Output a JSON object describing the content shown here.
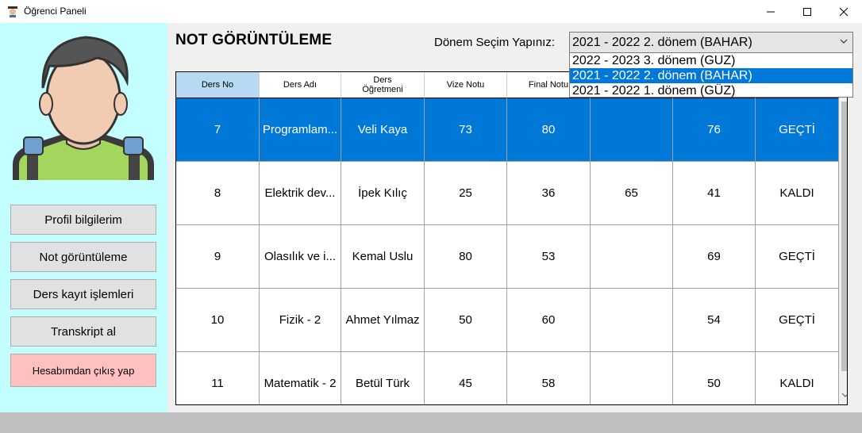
{
  "window": {
    "title": "Öğrenci Paneli"
  },
  "sidebar": {
    "buttons": {
      "profile": "Profil bilgilerim",
      "grades": "Not görüntüleme",
      "register": "Ders kayıt işlemleri",
      "transcript": "Transkript al",
      "logout": "Hesabımdan çıkış yap"
    }
  },
  "main": {
    "title": "NOT GÖRÜNTÜLEME",
    "term_label": "Dönem Seçim Yapınız:",
    "term_selected": "2021 - 2022 2. dönem (BAHAR)",
    "term_options": [
      "2022 - 2023 3. dönem (GUZ)",
      "2021 - 2022 2. dönem (BAHAR)",
      "2021 - 2022 1. dönem (GÜZ)"
    ]
  },
  "grid": {
    "columns": [
      "Ders No",
      "Ders Adı",
      "Ders Öğretmeni",
      "Vize Notu",
      "Final Notu",
      "",
      "",
      ""
    ],
    "rows": [
      [
        "7",
        "Programlam...",
        "Veli Kaya",
        "73",
        "80",
        "",
        "76",
        "GEÇTİ"
      ],
      [
        "8",
        "Elektrik dev...",
        "İpek Kılıç",
        "25",
        "36",
        "65",
        "41",
        "KALDI"
      ],
      [
        "9",
        "Olasılık ve i...",
        "Kemal Uslu",
        "80",
        "53",
        "",
        "69",
        "GEÇTİ"
      ],
      [
        "10",
        "Fizik - 2",
        "Ahmet Yılmaz",
        "50",
        "60",
        "",
        "54",
        "GEÇTİ"
      ],
      [
        "11",
        "Matematik - 2",
        "Betül Türk",
        "45",
        "58",
        "",
        "50",
        "KALDI"
      ]
    ]
  },
  "colors": {
    "sidebar_bg": "#c4ffff",
    "selection": "#0078d7",
    "logout_bg": "#ffc0c0",
    "header_active": "#b8d9f2"
  },
  "icons": [
    "student-app-icon",
    "minimize-icon",
    "maximize-icon",
    "close-icon",
    "avatar-icon",
    "chevron-down-icon"
  ]
}
